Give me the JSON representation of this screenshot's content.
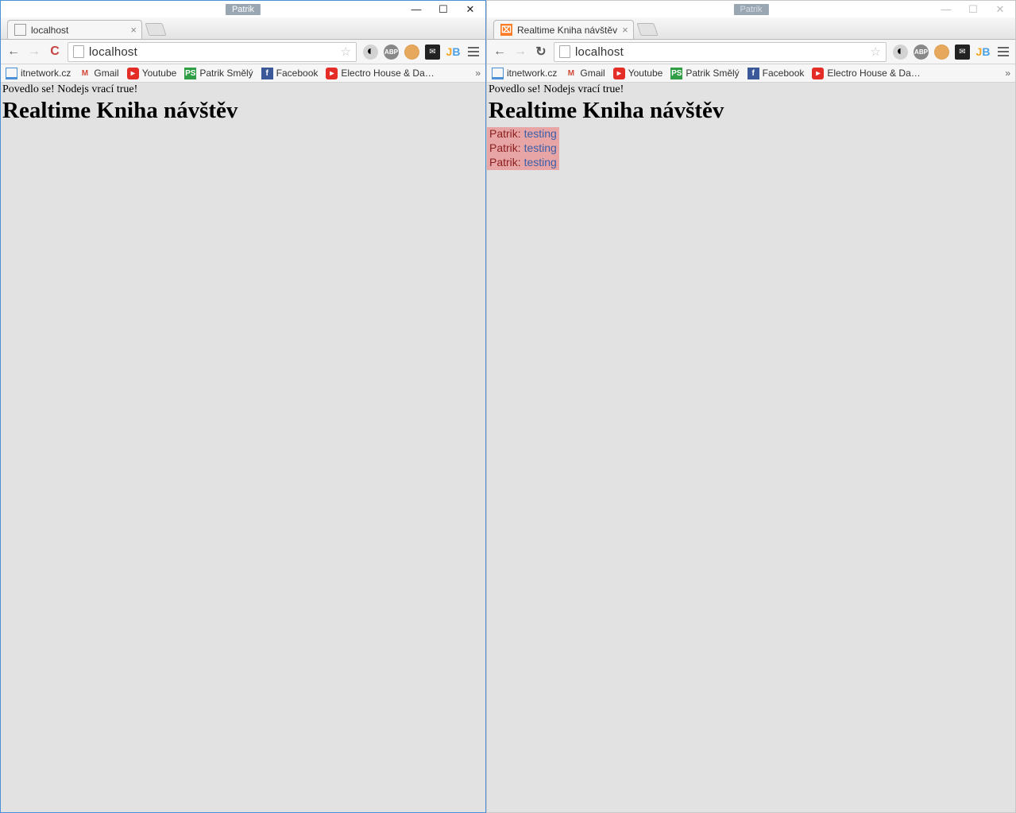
{
  "user_badge": "Patrik",
  "left": {
    "tab_title": "localhost",
    "url": "localhost",
    "status_line": "Povedlo se! Nodejs vrací true!",
    "heading": "Realtime Kniha návštěv"
  },
  "right": {
    "tab_title": "Realtime Kniha návštěv",
    "url": "localhost",
    "status_line": "Povedlo se! Nodejs vrací true!",
    "heading": "Realtime Kniha návštěv",
    "rows": [
      {
        "name": "Patrik",
        "sep": ": ",
        "msg": "testing"
      },
      {
        "name": "Patrik",
        "sep": ": ",
        "msg": "testing"
      },
      {
        "name": "Patrik",
        "sep": ": ",
        "msg": "testing"
      }
    ]
  },
  "bookmarks": [
    {
      "icon": "laptop",
      "label": "itnetwork.cz"
    },
    {
      "icon": "gmail",
      "label": "Gmail"
    },
    {
      "icon": "yt",
      "label": "Youtube"
    },
    {
      "icon": "ps",
      "label": "Patrik Smělý"
    },
    {
      "icon": "fb",
      "label": "Facebook"
    },
    {
      "icon": "yt",
      "label": "Electro House & Da…"
    }
  ]
}
